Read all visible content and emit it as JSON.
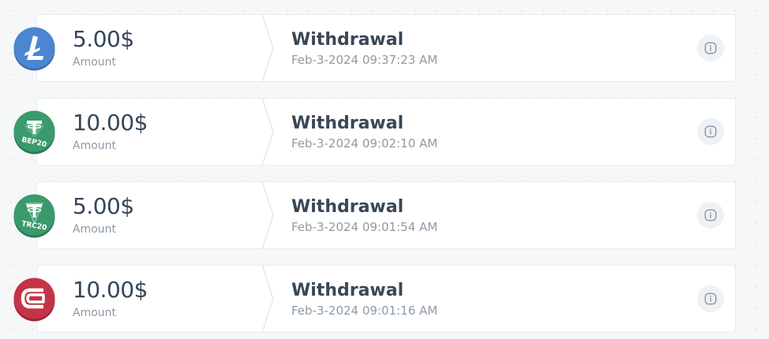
{
  "colors": {
    "litecoin": "#4a86d1",
    "tether": "#3b9a6c",
    "wallet": "#c33446",
    "text_primary": "#35465a",
    "text_muted": "#8d9aa6"
  },
  "transactions": [
    {
      "coin_icon": "litecoin-icon",
      "amount": "5.00$",
      "amount_label": "Amount",
      "type": "Withdrawal",
      "date": "Feb-3-2024 09:37:23 AM",
      "action_icon": "info-icon"
    },
    {
      "coin_icon": "tether-bep20-icon",
      "coin_badge": "BEP20",
      "amount": "10.00$",
      "amount_label": "Amount",
      "type": "Withdrawal",
      "date": "Feb-3-2024 09:02:10 AM",
      "action_icon": "info-icon"
    },
    {
      "coin_icon": "tether-trc20-icon",
      "coin_badge": "TRC20",
      "amount": "5.00$",
      "amount_label": "Amount",
      "type": "Withdrawal",
      "date": "Feb-3-2024 09:01:54 AM",
      "action_icon": "info-icon"
    },
    {
      "coin_icon": "wallet-coin-icon",
      "amount": "10.00$",
      "amount_label": "Amount",
      "type": "Withdrawal",
      "date": "Feb-3-2024 09:01:16 AM",
      "action_icon": "info-icon"
    }
  ]
}
